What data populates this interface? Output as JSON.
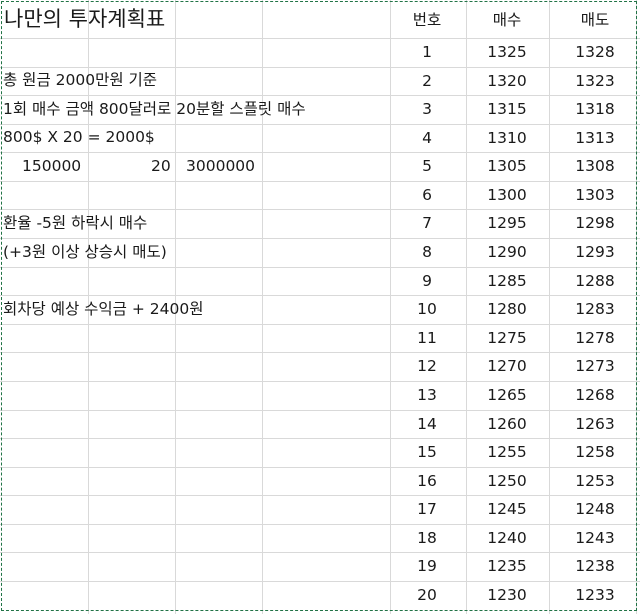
{
  "title": "나만의 투자계획표",
  "notes": [
    "총 원금 2000만원 기준",
    "1회 매수 금액 800달러로 20분할 스플릿 매수",
    "800$ X 20 = 2000$",
    "환율 -5원 하락시 매수",
    "(+3원 이상 상승시 매도)",
    "회차당 예상 수익금 + 2400원"
  ],
  "calc": {
    "a": "150000",
    "b": "20",
    "c": "3000000"
  },
  "table": {
    "headers": [
      "번호",
      "매수",
      "매도"
    ],
    "rows": [
      [
        "1",
        "1325",
        "1328"
      ],
      [
        "2",
        "1320",
        "1323"
      ],
      [
        "3",
        "1315",
        "1318"
      ],
      [
        "4",
        "1310",
        "1313"
      ],
      [
        "5",
        "1305",
        "1308"
      ],
      [
        "6",
        "1300",
        "1303"
      ],
      [
        "7",
        "1295",
        "1298"
      ],
      [
        "8",
        "1290",
        "1293"
      ],
      [
        "9",
        "1285",
        "1288"
      ],
      [
        "10",
        "1280",
        "1283"
      ],
      [
        "11",
        "1275",
        "1278"
      ],
      [
        "12",
        "1270",
        "1273"
      ],
      [
        "13",
        "1265",
        "1268"
      ],
      [
        "14",
        "1260",
        "1263"
      ],
      [
        "15",
        "1255",
        "1258"
      ],
      [
        "16",
        "1250",
        "1253"
      ],
      [
        "17",
        "1245",
        "1248"
      ],
      [
        "18",
        "1240",
        "1243"
      ],
      [
        "19",
        "1235",
        "1238"
      ],
      [
        "20",
        "1230",
        "1233"
      ]
    ]
  }
}
